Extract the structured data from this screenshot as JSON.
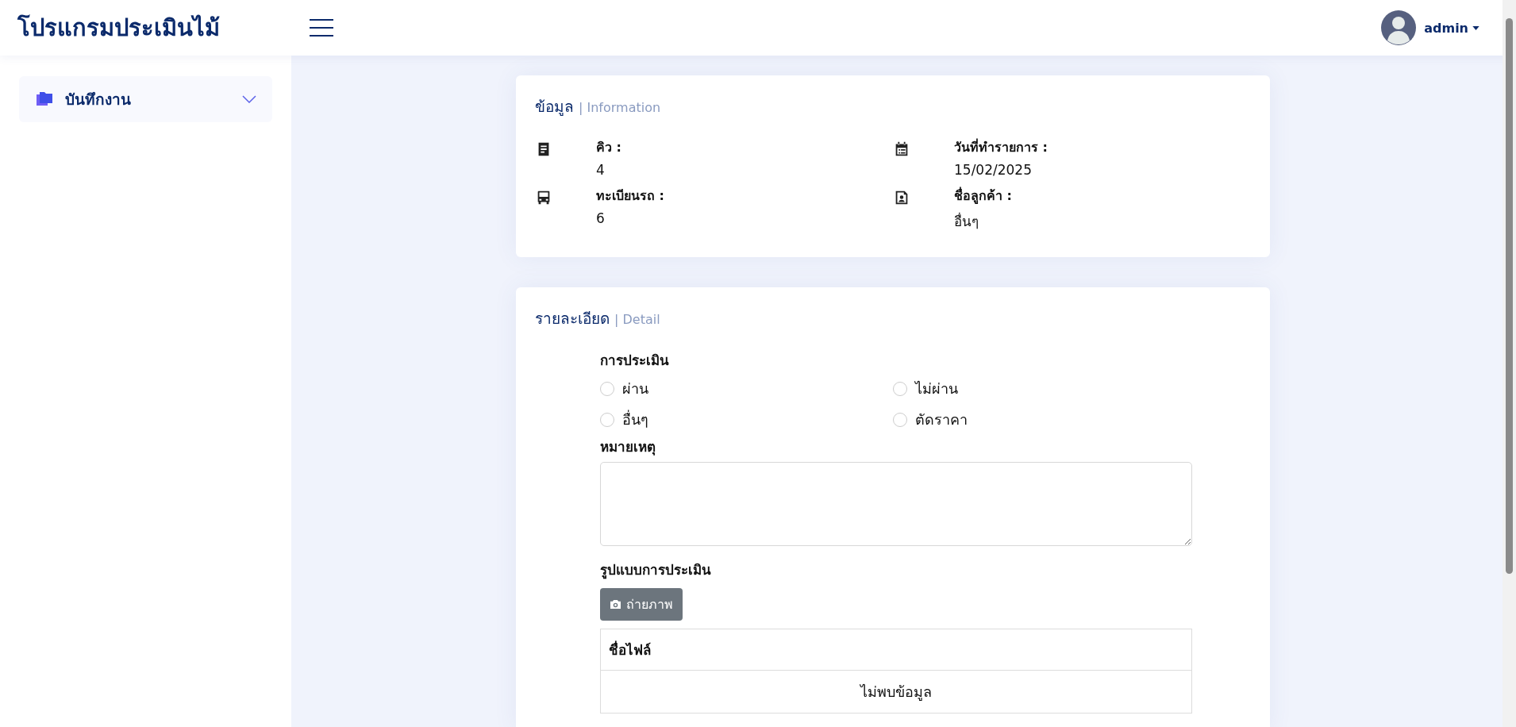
{
  "header": {
    "title": "โปรแกรมประเมินไม้",
    "user": "admin"
  },
  "sidebar": {
    "items": [
      {
        "label": "บันทึกงาน",
        "expanded": false
      }
    ]
  },
  "info": {
    "title": "ข้อมูล",
    "subtitle": "| Information",
    "fields": [
      {
        "kind": "queue",
        "label": "คิว :",
        "value": "4"
      },
      {
        "kind": "date",
        "label": "วันที่ทำรายการ :",
        "value": "15/02/2025"
      },
      {
        "kind": "vehicle",
        "label": "ทะเบียนรถ :",
        "value": "6"
      },
      {
        "kind": "customer",
        "label": "ชื่อลูกค้า :",
        "value": "อื่นๆ"
      }
    ]
  },
  "detail": {
    "title": "รายละเอียด",
    "subtitle": "| Detail",
    "assessment": {
      "label": "การประเมิน",
      "options": [
        {
          "label": "ผ่าน",
          "selected": false
        },
        {
          "label": "ไม่ผ่าน",
          "selected": false
        },
        {
          "label": "อื่นๆ",
          "selected": false
        },
        {
          "label": "ตัดราคา",
          "selected": false
        }
      ]
    },
    "note": {
      "label": "หมายเหตุ"
    },
    "photos": {
      "label": "รูปแบบการประเมิน",
      "button": "ถ่ายภาพ"
    },
    "table": {
      "columns": [
        "ชื่อไฟล์"
      ],
      "empty": "ไม่พบข้อมูล"
    }
  }
}
